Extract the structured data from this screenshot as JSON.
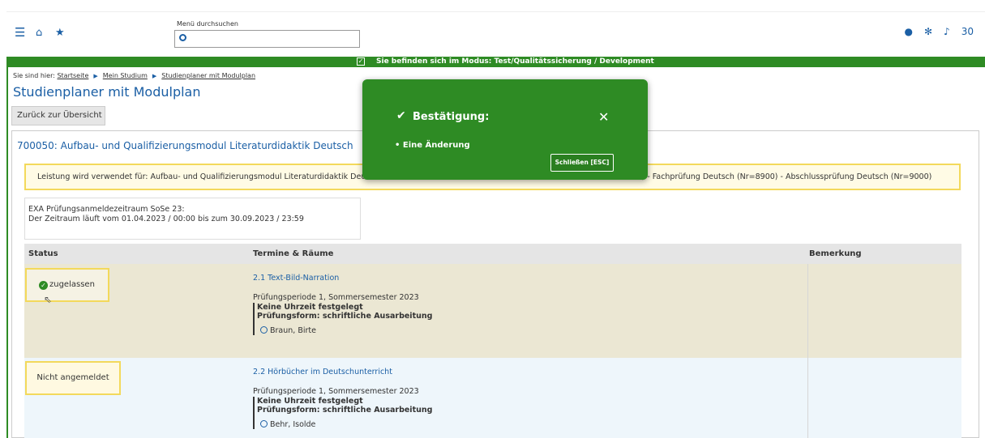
{
  "header": {
    "menu_label": "Menü durchsuchen",
    "search_value": "",
    "notification_count": "30"
  },
  "mode_bar": {
    "text": "Sie befinden sich im Modus: Test/Qualitätssicherung / Development"
  },
  "breadcrumb": {
    "prefix": "Sie sind hier:",
    "items": [
      "Startseite",
      "Mein Studium",
      "Studienplaner mit Modulplan"
    ]
  },
  "page": {
    "title": "Studienplaner mit Modulplan",
    "back_button": "Zurück zur Übersicht"
  },
  "module": {
    "title": "700050: Aufbau- und Qualifizierungsmodul Literaturdidaktik Deutsch",
    "leistung_start": "Leistung wird verwendet für: Aufbau- und Qualifizierungsmodul Literaturdidaktik Deu",
    "leistung_end": "K) - Fachprüfung Deutsch (Nr=8900) - Abschlussprüfung Deutsch (Nr=9000)",
    "zeitraum_line1": "EXA Prüfungsanmeldezeitraum SoSe 23:",
    "zeitraum_line2": "Der Zeitraum läuft vom 01.04.2023 / 00:00 bis zum 30.09.2023 / 23:59"
  },
  "table": {
    "headers": {
      "status": "Status",
      "termine": "Termine & Räume",
      "bemerkung": "Bemerkung"
    },
    "rows": [
      {
        "status": "zugelassen",
        "title": "2.1 Text-Bild-Narration",
        "period": "Prüfungsperiode 1, Sommersemester 2023",
        "time": "Keine Uhrzeit festgelegt",
        "form": "Prüfungsform: schriftliche Ausarbeitung",
        "person": "Braun, Birte"
      },
      {
        "status": "Nicht angemeldet",
        "title": "2.2 Hörbücher im Deutschunterricht",
        "period": "Prüfungsperiode 1, Sommersemester 2023",
        "time": "Keine Uhrzeit festgelegt",
        "form": "Prüfungsform: schriftliche Ausarbeitung",
        "person": "Behr, Isolde"
      }
    ]
  },
  "modal": {
    "title": "Bestätigung:",
    "item": "Eine Änderung",
    "close_button": "Schließen [ESC]"
  },
  "colors": {
    "brand_green": "#2e8b24",
    "link_blue": "#1b5fa5",
    "highlight_yellow": "#f3d95b"
  }
}
